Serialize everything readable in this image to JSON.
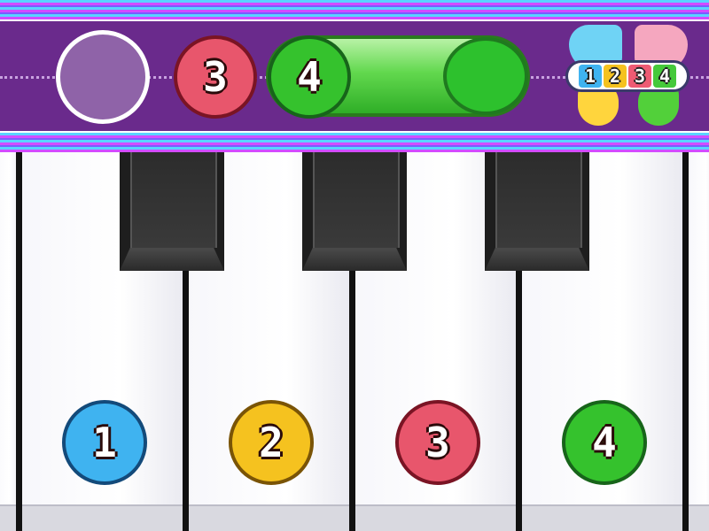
{
  "top_bar": {
    "incoming_notes": [
      "3",
      "4"
    ],
    "counter_numbers": [
      "1",
      "2",
      "3",
      "4"
    ]
  },
  "keys": {
    "note_labels": [
      "1",
      "2",
      "3",
      "4"
    ]
  },
  "colors": {
    "lane_1": "#3fb3f0",
    "lane_2": "#f5c21f",
    "lane_3": "#e8566c",
    "lane_4": "#35c22d",
    "band": "#6a2a8c"
  }
}
